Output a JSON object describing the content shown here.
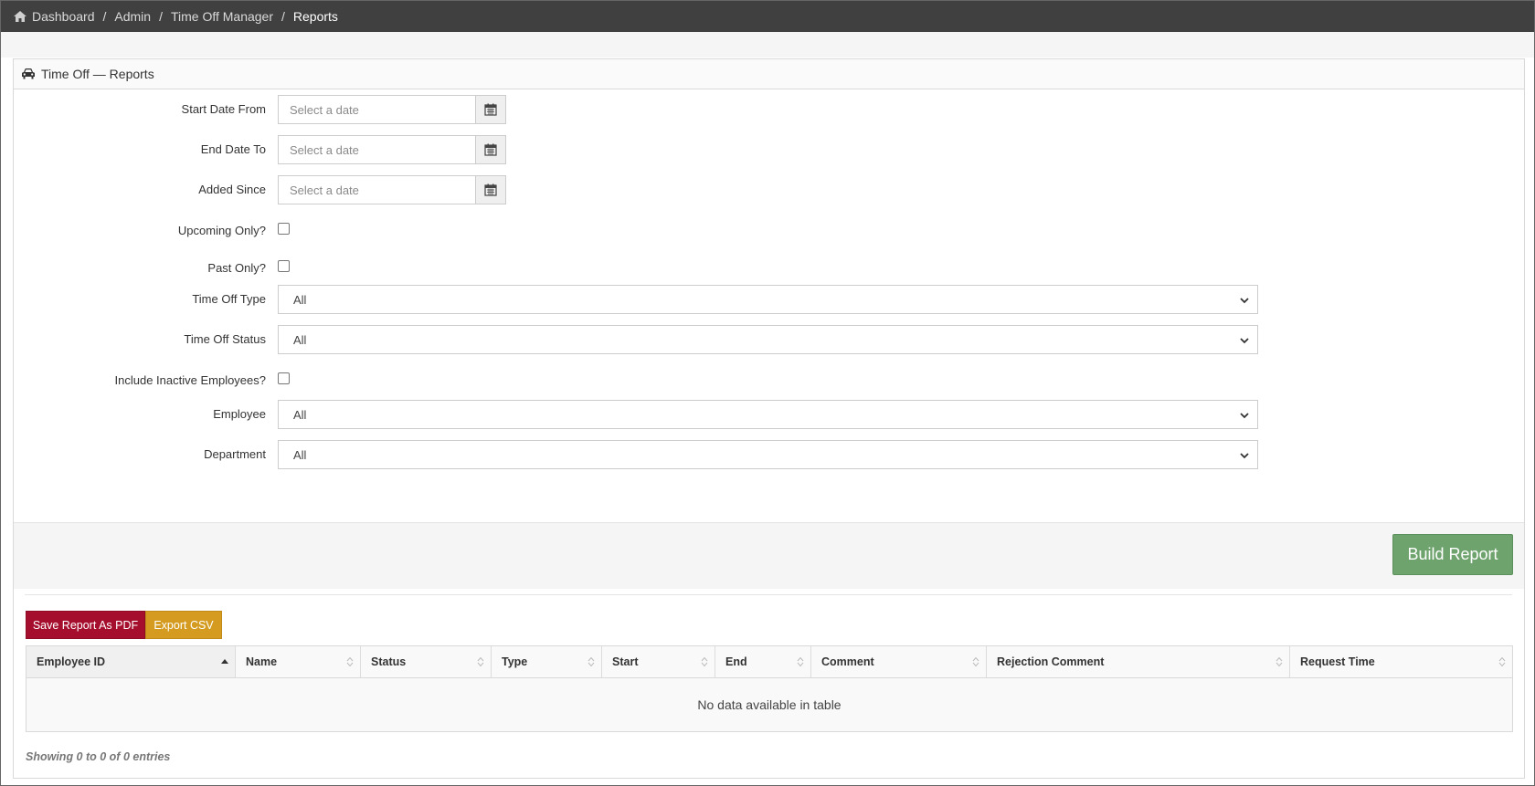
{
  "breadcrumb": {
    "items": [
      "Dashboard",
      "Admin",
      "Time Off Manager"
    ],
    "current": "Reports",
    "separator": "/"
  },
  "panel": {
    "title": "Time Off — Reports",
    "icon": "car-icon"
  },
  "form": {
    "start_date_from": {
      "label": "Start Date From",
      "placeholder": "Select a date"
    },
    "end_date_to": {
      "label": "End Date To",
      "placeholder": "Select a date"
    },
    "added_since": {
      "label": "Added Since",
      "placeholder": "Select a date"
    },
    "upcoming_only": {
      "label": "Upcoming Only?",
      "checked": false
    },
    "past_only": {
      "label": "Past Only?",
      "checked": false
    },
    "time_off_type": {
      "label": "Time Off Type",
      "value": "All"
    },
    "time_off_status": {
      "label": "Time Off Status",
      "value": "All"
    },
    "include_inactive": {
      "label": "Include Inactive Employees?",
      "checked": false
    },
    "employee": {
      "label": "Employee",
      "value": "All"
    },
    "department": {
      "label": "Department",
      "value": "All"
    },
    "build_button": "Build Report"
  },
  "actions": {
    "save_pdf": "Save Report As PDF",
    "export_csv": "Export CSV"
  },
  "table": {
    "columns": [
      "Employee ID",
      "Name",
      "Status",
      "Type",
      "Start",
      "End",
      "Comment",
      "Rejection Comment",
      "Request Time"
    ],
    "sorted_column": "Employee ID",
    "empty_message": "No data available in table",
    "info": "Showing 0 to 0 of 0 entries"
  },
  "colors": {
    "topbar": "#404040",
    "build_button": "#6ea36e",
    "pdf_button": "#a50e2d",
    "csv_button": "#d49b20"
  }
}
